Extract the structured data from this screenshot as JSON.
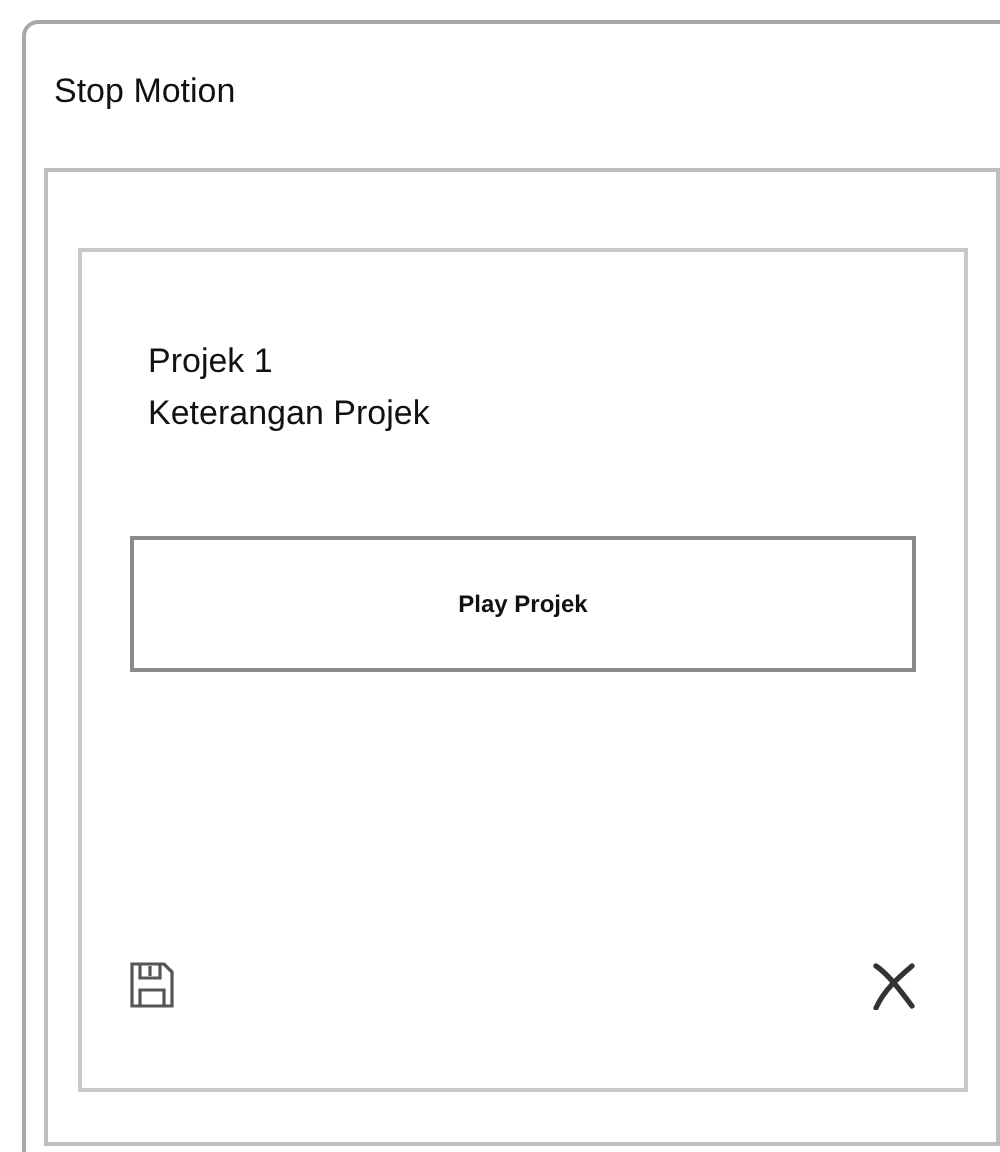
{
  "window": {
    "title": "Stop Motion"
  },
  "project": {
    "name": "Projek 1",
    "description": "Keterangan Projek"
  },
  "play_button": {
    "label": "Play Projek"
  }
}
